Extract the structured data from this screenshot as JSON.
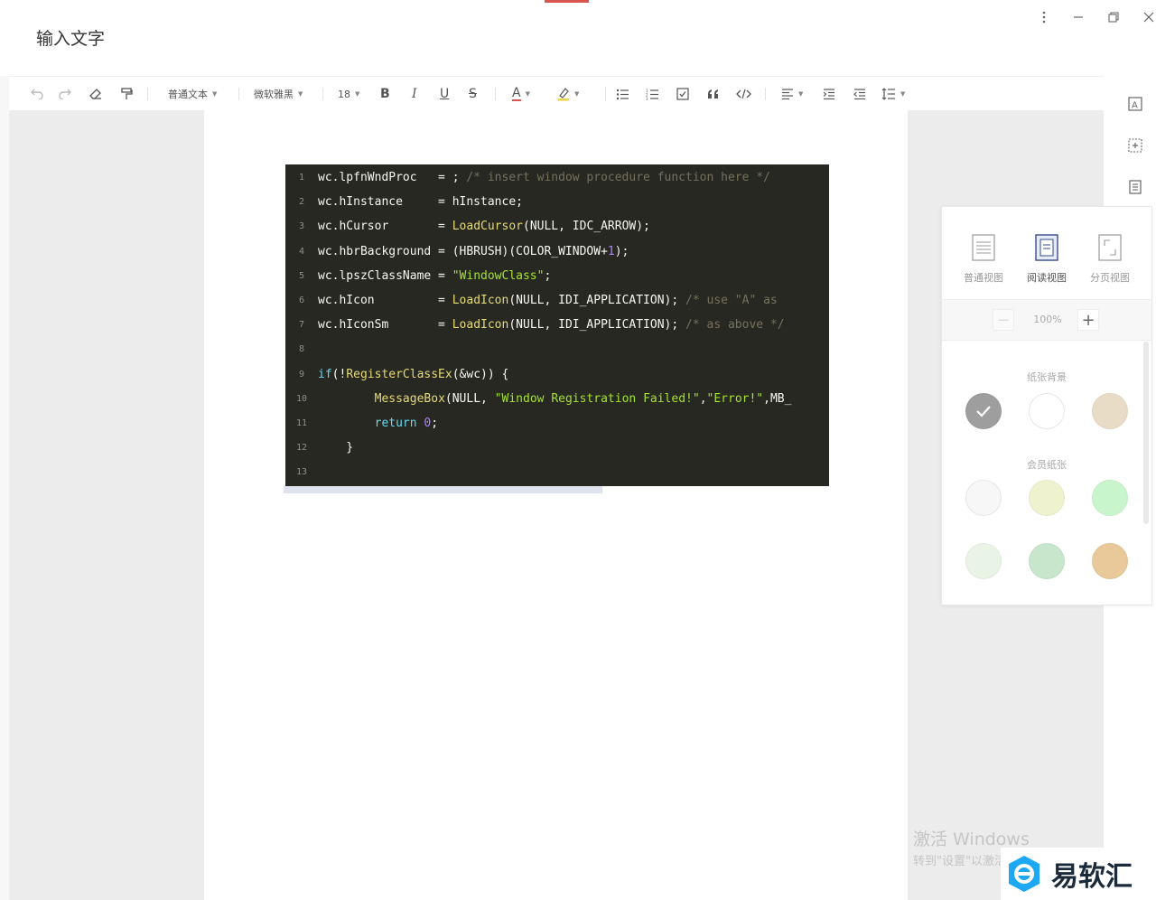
{
  "window": {
    "title": "输入文字",
    "menu_icon": "more-vertical-icon",
    "minimize_icon": "minimize-icon",
    "restore_icon": "restore-icon",
    "close_icon": "close-icon"
  },
  "toolbar": {
    "paragraph_style": "普通文本",
    "font_family": "微软雅黑",
    "font_size": "18",
    "bold": "B",
    "italic": "I",
    "underline": "U",
    "strike": "S",
    "font_color": "A"
  },
  "code": {
    "lines": [
      {
        "n": "1",
        "text": "wc.lpfnWndProc   = ; /* insert window procedure function here */"
      },
      {
        "n": "2",
        "text": "wc.hInstance     = hInstance;"
      },
      {
        "n": "3",
        "text": "wc.hCursor       = LoadCursor(NULL, IDC_ARROW);"
      },
      {
        "n": "4",
        "text": "wc.hbrBackground = (HBRUSH)(COLOR_WINDOW+1);"
      },
      {
        "n": "5",
        "text": "wc.lpszClassName = \"WindowClass\";"
      },
      {
        "n": "6",
        "text": "wc.hIcon         = LoadIcon(NULL, IDI_APPLICATION); /* use \"A\" as"
      },
      {
        "n": "7",
        "text": "wc.hIconSm       = LoadIcon(NULL, IDI_APPLICATION); /* as above */"
      },
      {
        "n": "8",
        "text": ""
      },
      {
        "n": "9",
        "text": "if(!RegisterClassEx(&wc)) {"
      },
      {
        "n": "10",
        "text": "        MessageBox(NULL, \"Window Registration Failed!\",\"Error!\",MB_"
      },
      {
        "n": "11",
        "text": "        return 0;"
      },
      {
        "n": "12",
        "text": "    }"
      },
      {
        "n": "13",
        "text": ""
      }
    ]
  },
  "view_panel": {
    "views": [
      {
        "label": "普通视图",
        "active": false
      },
      {
        "label": "阅读视图",
        "active": true
      },
      {
        "label": "分页视图",
        "active": false
      }
    ],
    "zoom": "100%",
    "zoom_out": "−",
    "zoom_in": "+",
    "paper_bg_label": "纸张背景",
    "member_paper_label": "会员纸张",
    "paper_backgrounds": [
      "#9e9e9e",
      "#ffffff",
      "#e9dcc6"
    ],
    "member_papers": [
      "#f7f7f7",
      "#eef2cf",
      "#c9f5cd",
      "#e9f4e6",
      "#c7e6cb",
      "#e9c99a"
    ]
  },
  "watermark": {
    "line1": "激活 Windows",
    "line2": "转到\"设置\"以激活"
  },
  "brand": {
    "name": "易软汇",
    "color": "#1ea7f2"
  }
}
